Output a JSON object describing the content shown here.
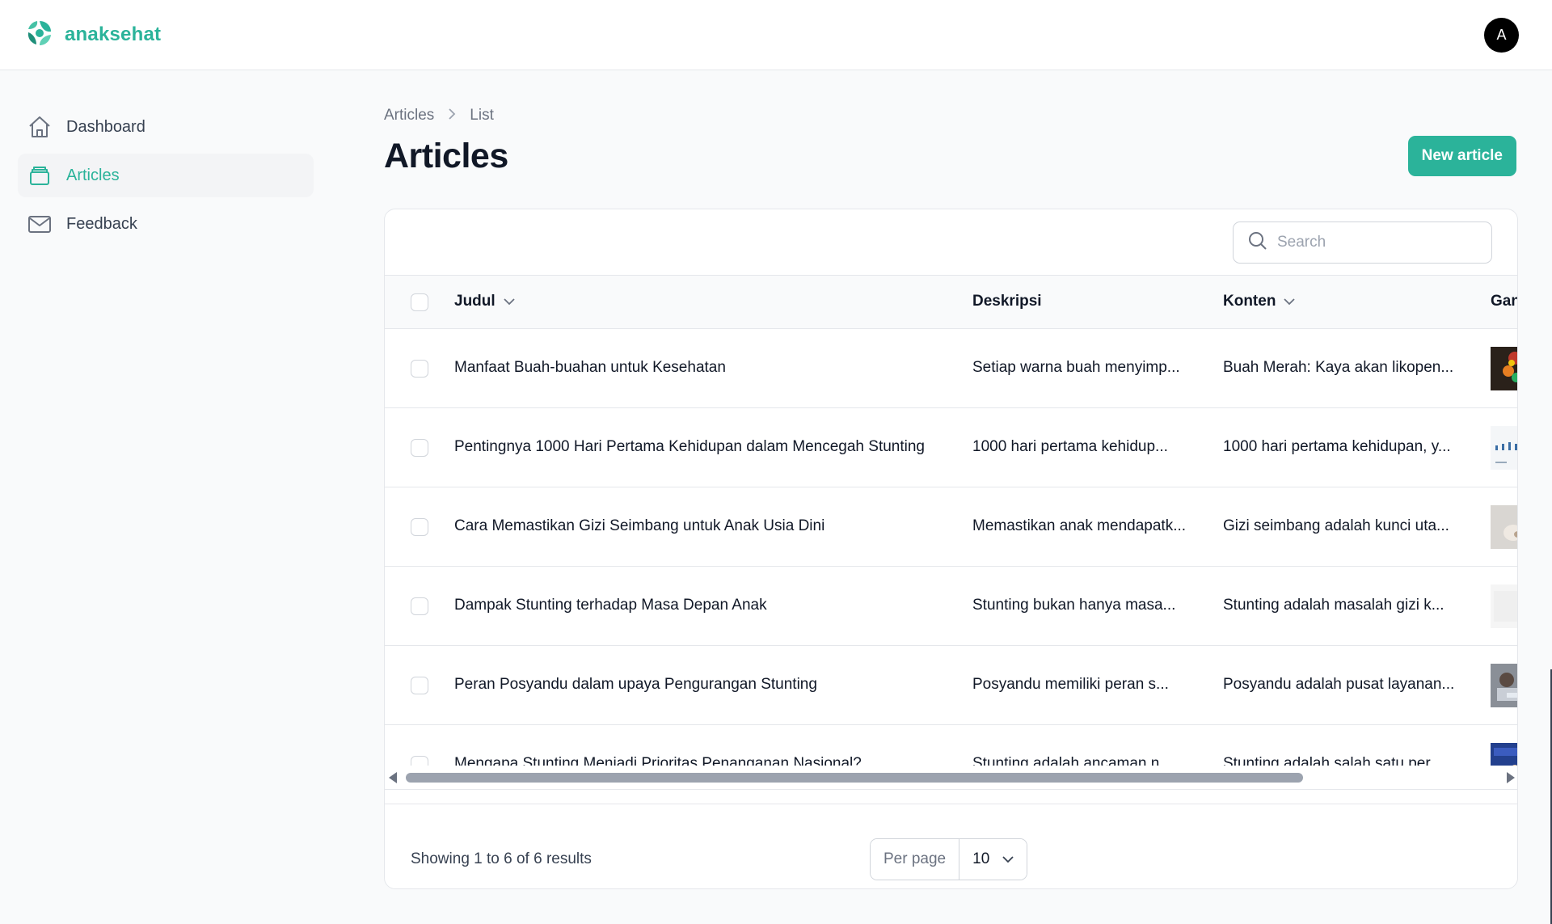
{
  "app": {
    "brand": "anaksehat",
    "avatar_initial": "A",
    "accent": "#2bb39a"
  },
  "sidebar": {
    "items": [
      {
        "label": "Dashboard",
        "icon": "home-icon",
        "active": false
      },
      {
        "label": "Articles",
        "icon": "box-icon",
        "active": true
      },
      {
        "label": "Feedback",
        "icon": "mail-icon",
        "active": false
      }
    ]
  },
  "breadcrumb": {
    "parent": "Articles",
    "current": "List"
  },
  "page": {
    "title": "Articles",
    "new_button": "New article"
  },
  "search": {
    "placeholder": "Search",
    "value": ""
  },
  "table": {
    "columns": {
      "judul": "Judul",
      "deskripsi": "Deskripsi",
      "konten": "Konten",
      "gambar": "Gan"
    },
    "rows": [
      {
        "judul": "Manfaat Buah-buahan untuk Kesehatan",
        "deskripsi": "Setiap warna buah menyimp...",
        "konten": "Buah Merah: Kaya akan likopen..."
      },
      {
        "judul": "Pentingnya 1000 Hari Pertama Kehidupan dalam Mencegah Stunting",
        "deskripsi": "1000 hari pertama kehidup...",
        "konten": "1000 hari pertama kehidupan, y..."
      },
      {
        "judul": "Cara Memastikan Gizi Seimbang untuk Anak Usia Dini",
        "deskripsi": "Memastikan anak mendapatk...",
        "konten": "Gizi seimbang adalah kunci uta..."
      },
      {
        "judul": "Dampak Stunting terhadap Masa Depan Anak",
        "deskripsi": "Stunting bukan hanya masa...",
        "konten": "Stunting adalah masalah gizi k..."
      },
      {
        "judul": "Peran Posyandu dalam upaya Pengurangan Stunting",
        "deskripsi": "Posyandu memiliki peran s...",
        "konten": "Posyandu adalah pusat layanan..."
      },
      {
        "judul": "Mengapa Stunting Menjadi Prioritas Penanganan Nasional?",
        "deskripsi": "Stunting adalah ancaman n...",
        "konten": "Stunting adalah salah satu per..."
      }
    ]
  },
  "footer": {
    "results": "Showing 1 to 6 of 6 results",
    "per_page_label": "Per page",
    "per_page_value": "10"
  }
}
